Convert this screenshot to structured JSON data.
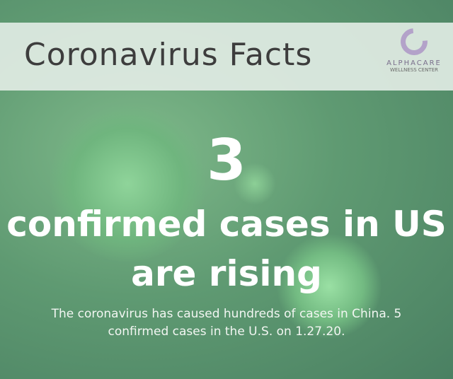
{
  "header": {
    "title": "Coronavirus Facts",
    "logo": {
      "brand": "ALPHACARE",
      "subtitle": "WELLNESS CENTER"
    }
  },
  "main": {
    "number": "3",
    "line1": "confirmed cases in US",
    "line2": "are rising",
    "description": "The coronavirus has caused hundreds of cases in China. 5 confirmed cases in the U.S. on 1.27.20."
  }
}
